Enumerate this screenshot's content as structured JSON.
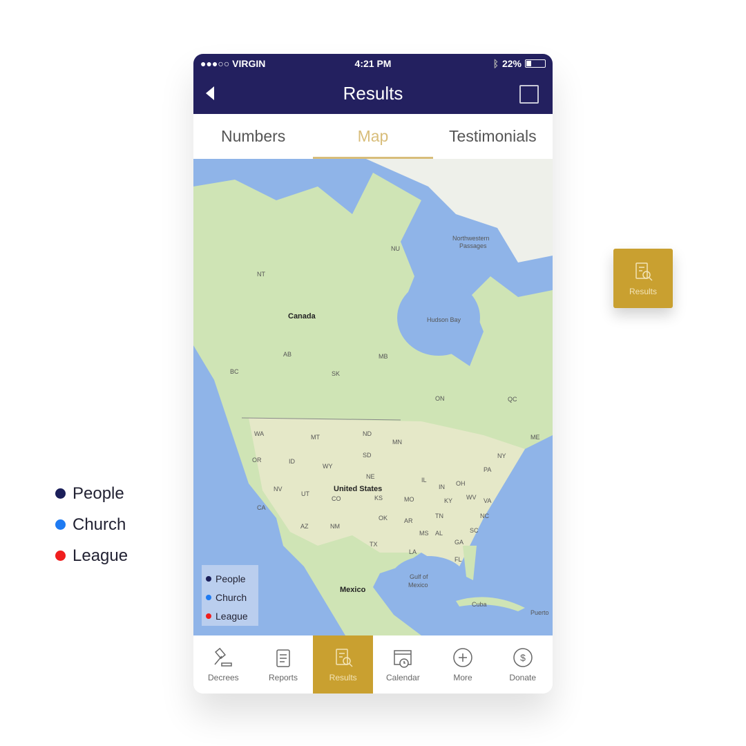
{
  "status_bar": {
    "carrier": "●●●○○ VIRGIN",
    "time": "4:21 PM",
    "battery": "22%"
  },
  "nav": {
    "title": "Results",
    "back_icon": "chevron-left-icon",
    "right_icon": "calendar-icon"
  },
  "tabs": [
    {
      "label": "Numbers"
    },
    {
      "label": "Map",
      "active": true
    },
    {
      "label": "Testimonials"
    }
  ],
  "map": {
    "labels": {
      "canada": "Canada",
      "us": "United States",
      "mexico": "Mexico",
      "hudson": "Hudson Bay",
      "nw1": "Northwestern",
      "nw2": "Passages",
      "gulf1": "Gulf of",
      "gulf2": "Mexico",
      "cuba": "Cuba",
      "puerto": "Puerto",
      "nu": "NU",
      "nt": "NT",
      "ab": "AB",
      "bc": "BC",
      "sk": "SK",
      "mb": "MB",
      "on": "ON",
      "qc": "QC",
      "wa": "WA",
      "mt": "MT",
      "nd": "ND",
      "mn": "MN",
      "or": "OR",
      "id": "ID",
      "sd": "SD",
      "wy": "WY",
      "ne": "NE",
      "nv": "NV",
      "ut": "UT",
      "co": "CO",
      "ks": "KS",
      "mo": "MO",
      "ca": "CA",
      "az": "AZ",
      "nm": "NM",
      "ok": "OK",
      "tx": "TX",
      "ar": "AR",
      "la": "LA",
      "ms": "MS",
      "al": "AL",
      "ga": "GA",
      "tn": "TN",
      "ky": "KY",
      "il": "IL",
      "in": "IN",
      "oh": "OH",
      "pa": "PA",
      "ny": "NY",
      "wv": "WV",
      "va": "VA",
      "nc": "NC",
      "sc": "SC",
      "fl": "FL",
      "me": "ME"
    }
  },
  "legend": [
    {
      "label": "People",
      "color": "#1b1f5a"
    },
    {
      "label": "Church",
      "color": "#1f7bf2"
    },
    {
      "label": "League",
      "color": "#f01e1e"
    }
  ],
  "tabbar": [
    {
      "label": "Decrees",
      "icon": "gavel-icon"
    },
    {
      "label": "Reports",
      "icon": "report-icon"
    },
    {
      "label": "Results",
      "icon": "results-icon",
      "active": true
    },
    {
      "label": "Calendar",
      "icon": "calendar-clock-icon"
    },
    {
      "label": "More",
      "icon": "plus-circle-icon"
    },
    {
      "label": "Donate",
      "icon": "dollar-circle-icon"
    }
  ],
  "floating_button": {
    "label": "Results",
    "icon": "results-icon"
  },
  "colors": {
    "navy": "#23205f",
    "gold": "#c9a030",
    "tab_active": "#d8bd7a"
  }
}
